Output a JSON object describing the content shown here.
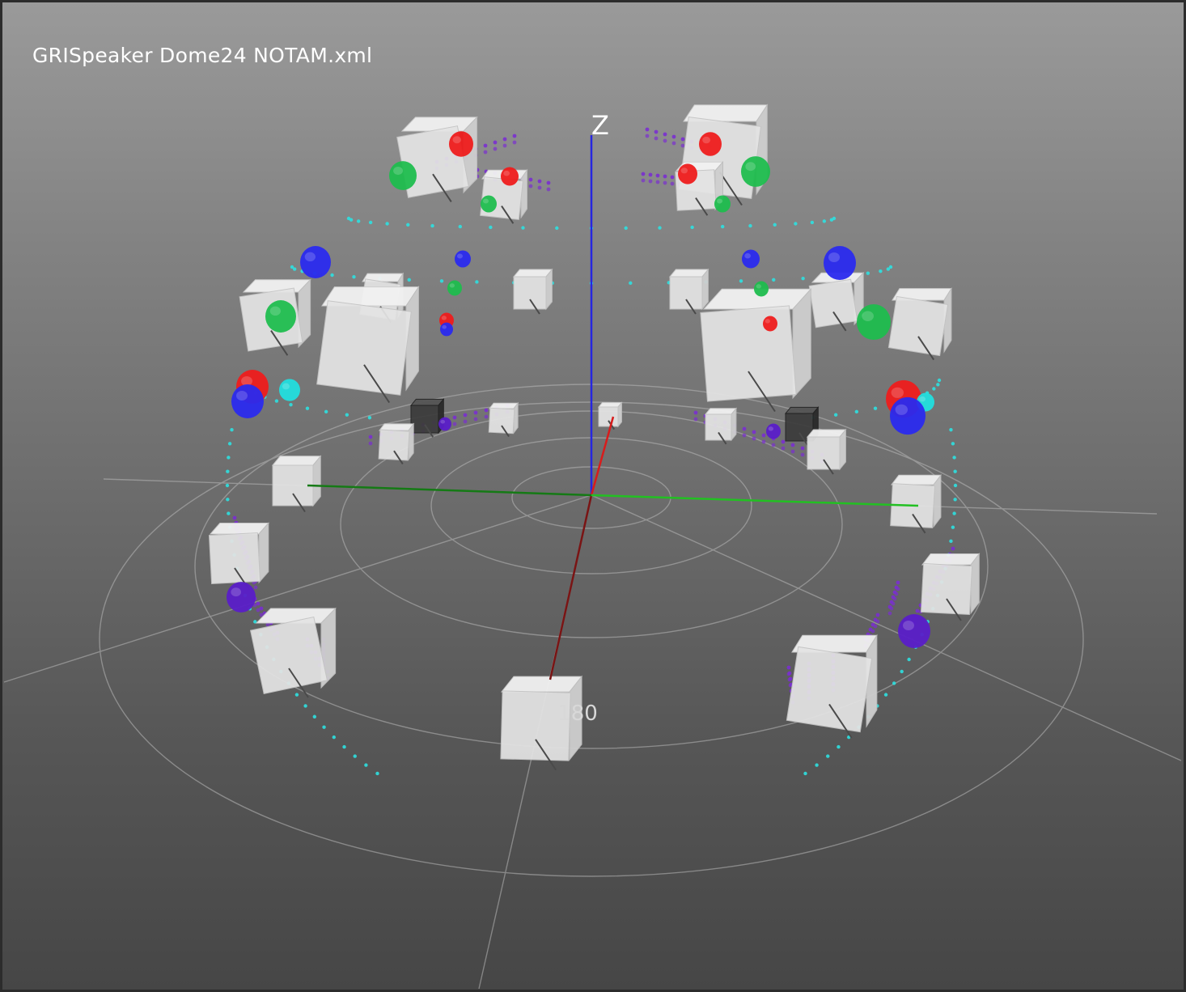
{
  "window": {
    "title": "GRISpeaker Dome24 NOTAM.xml"
  },
  "axes": {
    "z_label": "Z",
    "azimuth_label": "180"
  },
  "colors": {
    "x_axis": "#d81c1c",
    "y_axis": "#22c022",
    "z_axis": "#2626e0",
    "grid": "#b8b8b8",
    "speaker": "#e4e4e4",
    "speaker_dark": "#3c3c3c",
    "trail_purple": "#7a2fd0",
    "trail_cyan": "#2ee0e0",
    "source_red": "#ee1c1c",
    "source_green": "#1fbd4e",
    "source_blue": "#2a2aee",
    "source_cyan": "#22dede",
    "source_purple": "#5a1ec8"
  },
  "icons": {
    "speaker": "cube-icon",
    "source": "sphere-icon"
  }
}
